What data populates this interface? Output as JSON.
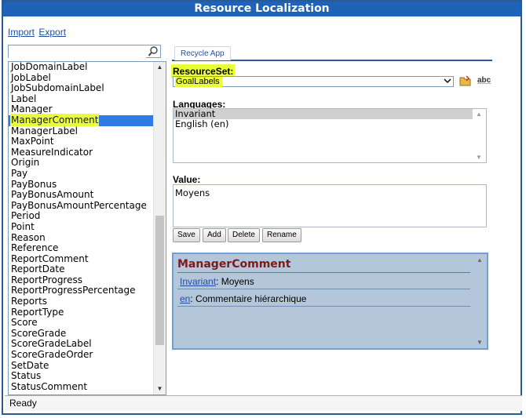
{
  "window": {
    "title": "Resource Localization"
  },
  "links": {
    "import": "Import",
    "export": "Export"
  },
  "search": {
    "value": "",
    "placeholder": ""
  },
  "resource_list": {
    "items": [
      "JobDomainLabel",
      "JobLabel",
      "JobSubdomainLabel",
      "Label",
      "Manager",
      "ManagerComment",
      "ManagerLabel",
      "MaxPoint",
      "MeasureIndicator",
      "Origin",
      "Pay",
      "PayBonus",
      "PayBonusAmount",
      "PayBonusAmountPercentage",
      "Period",
      "Point",
      "Reason",
      "Reference",
      "ReportComment",
      "ReportDate",
      "ReportProgress",
      "ReportProgressPercentage",
      "Reports",
      "ReportType",
      "Score",
      "ScoreGrade",
      "ScoreGradeLabel",
      "ScoreGradeOrder",
      "SetDate",
      "Status",
      "StatusComment"
    ],
    "selected": "ManagerComment"
  },
  "tabs": {
    "recycle": "Recycle App"
  },
  "resource_set": {
    "label": "ResourceSet:",
    "value": "GoalLabels"
  },
  "languages": {
    "label": "Languages:",
    "options": [
      "Invariant",
      "English (en)"
    ],
    "selected": "Invariant"
  },
  "value": {
    "label": "Value:",
    "text": "Moyens"
  },
  "buttons": {
    "save": "Save",
    "add": "Add",
    "delete": "Delete",
    "rename": "Rename"
  },
  "summary": {
    "title": "ManagerComment",
    "entries": [
      {
        "lang": "Invariant",
        "text": ": Moyens"
      },
      {
        "lang": "en",
        "text": ": Commentaire hiérarchique"
      }
    ]
  },
  "status": {
    "text": "Ready"
  },
  "icons": {
    "spell_glyph": "a̲b̲c̲"
  },
  "colors": {
    "title_bar": "#1f63b8",
    "selection": "#2f7be3",
    "highlight": "#e8ff3a",
    "summary_bg": "#b3c6da",
    "summary_title": "#7a1c1c"
  }
}
